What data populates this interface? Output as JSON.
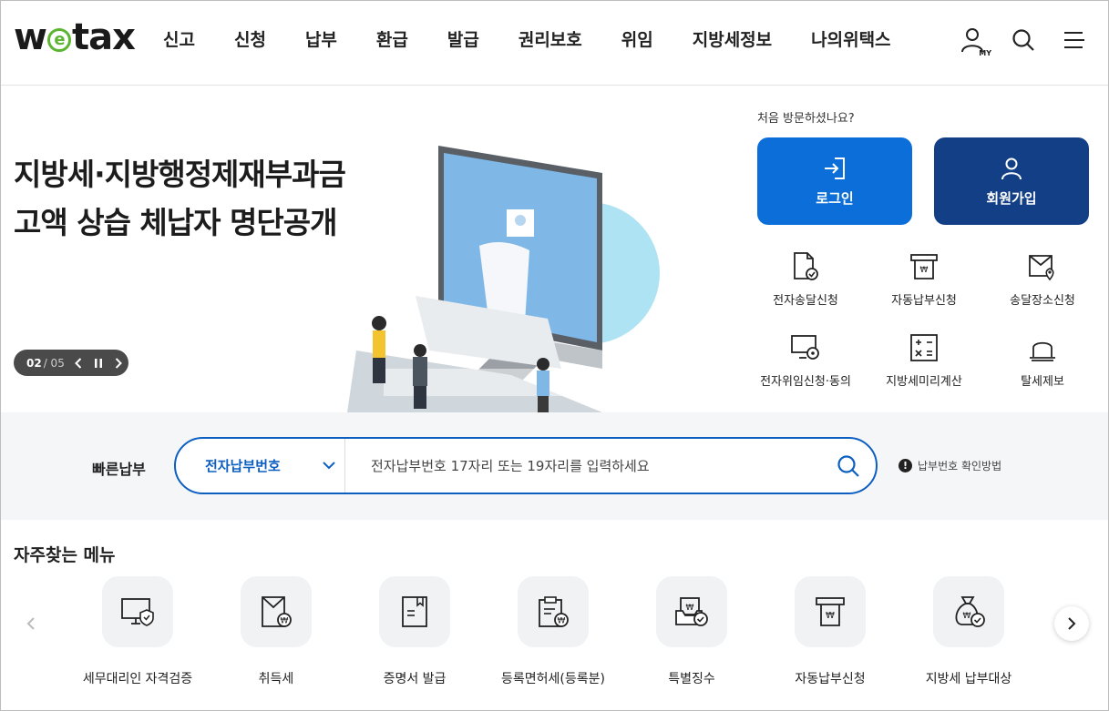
{
  "header": {
    "logo_prefix": "w",
    "logo_e": "e",
    "logo_suffix": "tax",
    "nav": [
      "신고",
      "신청",
      "납부",
      "환급",
      "발급",
      "권리보호",
      "위임",
      "지방세정보",
      "나의위택스"
    ],
    "my_label": "MY",
    "icons": [
      "user-my-icon",
      "search-icon",
      "hamburger-menu-icon"
    ]
  },
  "hero": {
    "title_line1": "지방세·지방행정제재부과금",
    "title_line2": "고액 상습 체납자 명단공개",
    "slide_current": "02",
    "slide_total": "/ 05"
  },
  "account": {
    "welcome": "처음 방문하셨나요?",
    "login_label": "로그인",
    "join_label": "회원가입"
  },
  "quick_menu": [
    {
      "label": "전자송달신청",
      "icon": "document-check-icon"
    },
    {
      "label": "자동납부신청",
      "icon": "auto-payment-icon"
    },
    {
      "label": "송달장소신청",
      "icon": "mail-location-icon"
    },
    {
      "label": "전자위임신청·동의",
      "icon": "monitor-delegate-icon"
    },
    {
      "label": "지방세미리계산",
      "icon": "calculator-icon"
    },
    {
      "label": "탈세제보",
      "icon": "alarm-bell-icon"
    }
  ],
  "fastpay": {
    "label": "빠른납부",
    "select_value": "전자납부번호",
    "placeholder": "전자납부번호 17자리 또는 19자리를 입력하세요",
    "help": "납부번호 확인방법",
    "help_mark": "!"
  },
  "frequent": {
    "title": "자주찾는 메뉴",
    "items": [
      {
        "label": "세무대리인 자격검증",
        "icon": "monitor-shield-icon"
      },
      {
        "label": "취득세",
        "icon": "acquisition-tax-icon"
      },
      {
        "label": "증명서 발급",
        "icon": "certificate-icon"
      },
      {
        "label": "등록면허세(등록분)",
        "icon": "registration-tax-icon"
      },
      {
        "label": "특별징수",
        "icon": "special-collection-icon"
      },
      {
        "label": "자동납부신청",
        "icon": "auto-payment-icon"
      },
      {
        "label": "지방세 납부대상",
        "icon": "money-bag-icon"
      }
    ]
  },
  "colors": {
    "primary_blue": "#0c6ed8",
    "navy": "#133f86",
    "logo_green": "#5cb531"
  }
}
